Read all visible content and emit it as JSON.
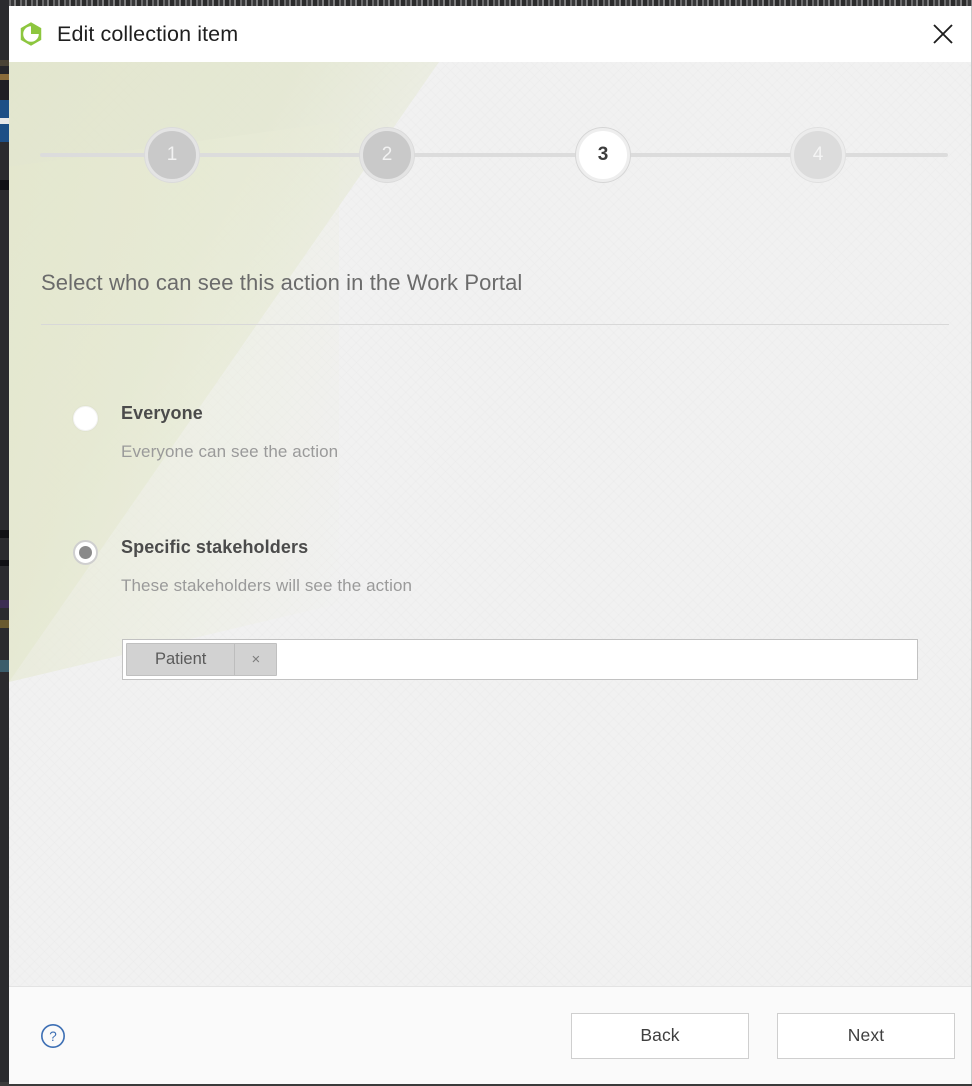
{
  "window": {
    "title": "Edit collection item",
    "app_icon": "hexagon-clock-logo",
    "close_icon": "close-icon",
    "brand_color": "#8dc63f"
  },
  "stepper": {
    "steps": [
      {
        "number": "1",
        "state": "done"
      },
      {
        "number": "2",
        "state": "done"
      },
      {
        "number": "3",
        "state": "active"
      },
      {
        "number": "4",
        "state": "future"
      }
    ]
  },
  "content": {
    "heading": "Select who can see this action in the Work Portal",
    "options": [
      {
        "title": "Everyone",
        "description": "Everyone can see the action",
        "selected": false
      },
      {
        "title": "Specific stakeholders",
        "description": "These stakeholders will see the action",
        "selected": true
      }
    ],
    "stakeholders_input": {
      "placeholder": "",
      "value": "",
      "tags": [
        {
          "label": "Patient",
          "remove_icon": "close-icon",
          "remove_glyph": "×"
        }
      ]
    }
  },
  "footer": {
    "help_icon": "help-circle-icon",
    "help_glyph": "?",
    "back_label": "Back",
    "next_label": "Next",
    "help_color": "#3d6fb4"
  }
}
